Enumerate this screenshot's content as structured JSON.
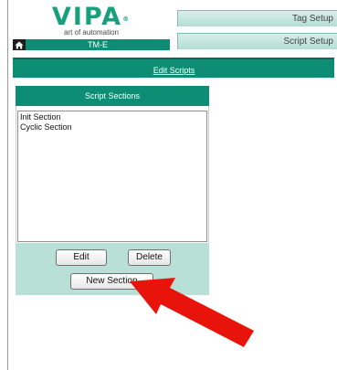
{
  "logo": {
    "brand": "VIPA",
    "reg": "®",
    "tagline": "art of automation"
  },
  "device": {
    "name": "TM-E",
    "icon": "home-icon"
  },
  "tabs": [
    {
      "label": "Tag Setup"
    },
    {
      "label": "Script Setup"
    }
  ],
  "page": {
    "title_link": "Edit Scripts"
  },
  "sections": {
    "header": "Script Sections",
    "items": [
      "Init Section",
      "Cyclic Section"
    ],
    "buttons": {
      "edit": "Edit",
      "delete": "Delete",
      "new": "New Section"
    }
  },
  "colors": {
    "brand_green": "#18a07e",
    "bar_teal": "#0d8e74",
    "panel_light": "#b9e0d6",
    "arrow_red": "#e8140c"
  }
}
